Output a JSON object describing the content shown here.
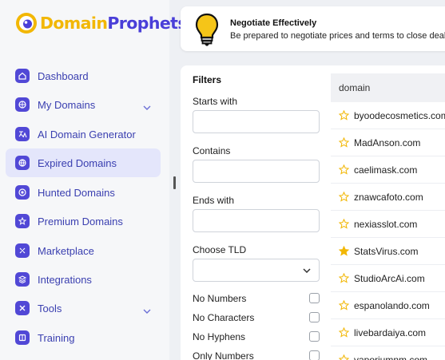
{
  "brand": {
    "part1": "Domain",
    "part2": "Prophets"
  },
  "sidebar": {
    "items": [
      {
        "label": "Dashboard",
        "icon": "home-icon"
      },
      {
        "label": "My Domains",
        "icon": "globe-icon",
        "expandable": true
      },
      {
        "label": "AI Domain Generator",
        "icon": "translate-icon"
      },
      {
        "label": "Expired Domains",
        "icon": "clock-globe-icon",
        "active": true
      },
      {
        "label": "Hunted Domains",
        "icon": "target-icon"
      },
      {
        "label": "Premium Domains",
        "icon": "star-badge-icon"
      },
      {
        "label": "Marketplace",
        "icon": "market-icon"
      },
      {
        "label": "Integrations",
        "icon": "layers-icon"
      },
      {
        "label": "Tools",
        "icon": "tools-icon",
        "expandable": true
      },
      {
        "label": "Training",
        "icon": "book-icon"
      }
    ]
  },
  "tip": {
    "title": "Negotiate Effectively",
    "text": "Be prepared to negotiate prices and terms to close deals"
  },
  "filters": {
    "title": "Filters",
    "starts_with_label": "Starts with",
    "contains_label": "Contains",
    "ends_with_label": "Ends with",
    "tld_label": "Choose TLD",
    "checks": [
      "No Numbers",
      "No Characters",
      "No Hyphens",
      "Only Numbers"
    ]
  },
  "table": {
    "header": "domain",
    "rows": [
      {
        "name": "byoodecosmetics.com",
        "starred": false
      },
      {
        "name": "MadAnson.com",
        "starred": false
      },
      {
        "name": "caelimask.com",
        "starred": false
      },
      {
        "name": "znawcafoto.com",
        "starred": false
      },
      {
        "name": "nexiasslot.com",
        "starred": false
      },
      {
        "name": "StatsVirus.com",
        "starred": true
      },
      {
        "name": "StudioArcAi.com",
        "starred": false
      },
      {
        "name": "espanolando.com",
        "starred": false
      },
      {
        "name": "livebardaiya.com",
        "starred": false
      },
      {
        "name": "vaporiumnm.com",
        "starred": false
      }
    ]
  },
  "colors": {
    "brand_yellow": "#f2b705",
    "brand_purple": "#4a3fd8",
    "star": "#f2b705"
  }
}
